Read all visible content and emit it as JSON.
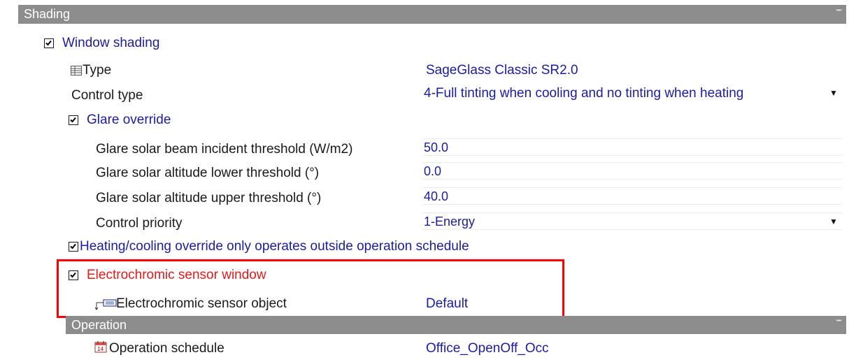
{
  "sections": {
    "shading": {
      "title": "Shading"
    },
    "operation": {
      "title": "Operation"
    }
  },
  "fields": {
    "window_shading": {
      "label": "Window shading",
      "checked": true
    },
    "type": {
      "label": "Type",
      "value": "SageGlass Classic SR2.0"
    },
    "control_type": {
      "label": "Control type",
      "value": "4-Full tinting when cooling and no tinting when heating"
    },
    "glare_override": {
      "label": "Glare override",
      "checked": true
    },
    "glare_beam": {
      "label": "Glare solar beam incident threshold (W/m2)",
      "value": "50.0"
    },
    "glare_alt_lower": {
      "label": "Glare solar altitude lower threshold (°)",
      "value": "0.0"
    },
    "glare_alt_upper": {
      "label": "Glare solar altitude upper threshold (°)",
      "value": "40.0"
    },
    "control_priority": {
      "label": "Control priority",
      "value": "1-Energy"
    },
    "hc_override": {
      "label": "Heating/cooling override only operates outside operation schedule",
      "checked": true
    },
    "ec_sensor_window": {
      "label": "Electrochromic sensor window",
      "checked": true
    },
    "ec_sensor_object": {
      "label": "Electrochromic sensor object",
      "value": "Default"
    },
    "operation_schedule": {
      "label": "Operation schedule",
      "value": "Office_OpenOff_Occ"
    }
  },
  "icons": {
    "collapse": "double-chevron-up-icon",
    "type": "table-grid-icon",
    "sensor": "sensor-link-icon",
    "schedule": "calendar-icon",
    "dropdown": "dropdown-arrow-icon"
  },
  "colors": {
    "link": "#1c1c9e",
    "highlight": "#ff0000",
    "header": "#8c8c8c",
    "red_text": "#e21a1a"
  }
}
